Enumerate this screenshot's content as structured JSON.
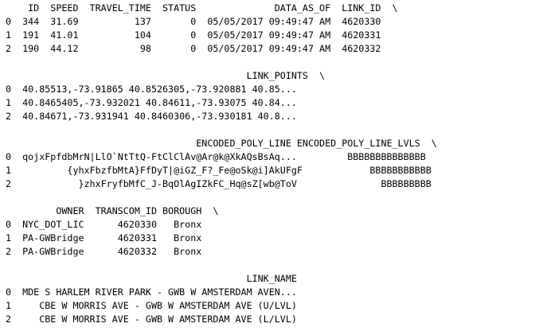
{
  "output": {
    "block1": {
      "header": "    ID  SPEED  TRAVEL_TIME  STATUS              DATA_AS_OF  LINK_ID  \\",
      "rows": [
        "0  344  31.69          137       0  05/05/2017 09:49:47 AM  4620330",
        "1  191  41.01          104       0  05/05/2017 09:49:47 AM  4620331",
        "2  190  44.12           98       0  05/05/2017 09:49:47 AM  4620332"
      ]
    },
    "block2": {
      "header": "                                           LINK_POINTS  \\",
      "rows": [
        "0  40.85513,-73.91865 40.8526305,-73.920881 40.85...",
        "1  40.8465405,-73.932021 40.84611,-73.93075 40.84...",
        "2  40.84671,-73.931941 40.8460306,-73.930181 40.8..."
      ]
    },
    "block3": {
      "header": "                                  ENCODED_POLY_LINE ENCODED_POLY_LINE_LVLS  \\",
      "rows": [
        "0  qojxFpfdbMrN|LlO`NtTtQ-FtClClAv@Ar@k@XkAQsBsAq...         BBBBBBBBBBBBBB",
        "1          {yhxFbzfbMtA}FfDyT|@iGZ_F?_Fe@oSk@i]AkUFgF            BBBBBBBBBBB",
        "2            }zhxFryfbMfC_J-BqOlAgIZkFC_Hq@sZ[wb@ToV               BBBBBBBBB"
      ]
    },
    "block4": {
      "header": "         OWNER  TRANSCOM_ID BOROUGH  \\",
      "rows": [
        "0  NYC_DOT_LIC      4620330   Bronx",
        "1  PA-GWBridge      4620331   Bronx",
        "2  PA-GWBridge      4620332   Bronx"
      ]
    },
    "block5": {
      "header": "                                           LINK_NAME",
      "rows": [
        "0  MDE S HARLEM RIVER PARK - GWB W AMSTERDAM AVEN...",
        "1     CBE W MORRIS AVE - GWB W AMSTERDAM AVE (U/LVL)",
        "2     CBE W MORRIS AVE - GWB W AMSTERDAM AVE (L/LVL)"
      ]
    }
  }
}
